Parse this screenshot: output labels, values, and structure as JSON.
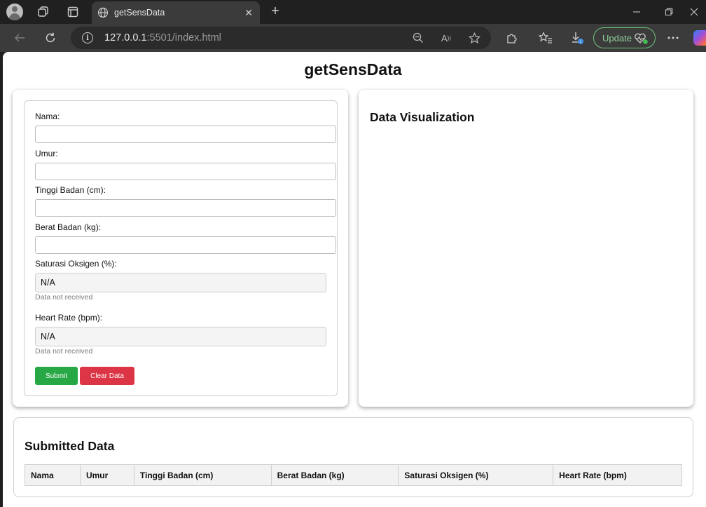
{
  "browser": {
    "tab_title": "getSensData",
    "tab_close_glyph": "✕",
    "new_tab_glyph": "+",
    "url_host": "127.0.0.1",
    "url_rest": ":5501/index.html",
    "update_label": "Update",
    "icons": [
      "profile-icon",
      "workspaces-icon",
      "tab-actions-icon",
      "globe-icon",
      "back-icon",
      "reload-icon",
      "info-icon",
      "zoom-out-icon",
      "read-aloud-icon",
      "favorite-star-icon",
      "extensions-icon",
      "favorites-icon",
      "downloads-icon",
      "more-icon",
      "copilot-icon"
    ]
  },
  "page": {
    "title": "getSensData"
  },
  "form": {
    "nama_label": "Nama:",
    "umur_label": "Umur:",
    "tinggi_label": "Tinggi Badan (cm):",
    "berat_label": "Berat Badan (kg):",
    "saturasi_label": "Saturasi Oksigen (%):",
    "saturasi_value": "N/A",
    "saturasi_hint": "Data not received",
    "heart_label": "Heart Rate (bpm):",
    "heart_value": "N/A",
    "heart_hint": "Data not received",
    "submit_label": "Submit",
    "clear_label": "Clear Data"
  },
  "visualization": {
    "title": "Data Visualization"
  },
  "submitted": {
    "title": "Submitted Data",
    "columns": [
      "Nama",
      "Umur",
      "Tinggi Badan (cm)",
      "Berat Badan (kg)",
      "Saturasi Oksigen (%)",
      "Heart Rate (bpm)"
    ]
  },
  "colors": {
    "submit": "#28a745",
    "clear": "#dc3545",
    "update_accent": "#6ec27a"
  }
}
